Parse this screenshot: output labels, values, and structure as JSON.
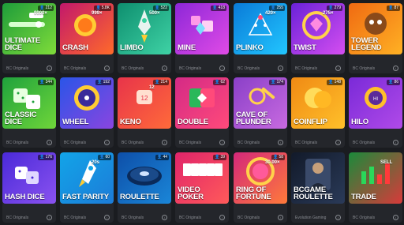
{
  "games": [
    {
      "title": "ULTIMATE DICE",
      "players": "212",
      "provider": "BC Originals",
      "badge": "9900×",
      "bg": [
        "#1e9c3a",
        "#7fdc3a"
      ]
    },
    {
      "title": "CRASH",
      "players": "5.8K",
      "provider": "BC Originals",
      "badge": "999×",
      "bg": [
        "#c2186b",
        "#ff6a2a"
      ]
    },
    {
      "title": "LIMBO",
      "players": "522",
      "provider": "BC Originals",
      "badge": "500×",
      "bg": [
        "#0e8f6f",
        "#3fd2a5"
      ]
    },
    {
      "title": "MINE",
      "players": "418",
      "provider": "BC Originals",
      "badge": "",
      "bg": [
        "#8d27d8",
        "#e04be6"
      ]
    },
    {
      "title": "PLINKO",
      "players": "255",
      "provider": "BC Originals",
      "badge": "420×",
      "bg": [
        "#0a7bd8",
        "#22c6ff"
      ]
    },
    {
      "title": "TWIST",
      "players": "279",
      "provider": "BC Originals",
      "badge": "275×",
      "bg": [
        "#6a22d8",
        "#d54ef0"
      ]
    },
    {
      "title": "TOWER LEGEND",
      "players": "87",
      "provider": "BC Originals",
      "badge": "",
      "bg": [
        "#f06a12",
        "#ffb124"
      ]
    },
    {
      "title": "CLASSIC DICE",
      "players": "344",
      "provider": "BC Originals",
      "badge": "",
      "bg": [
        "#1fa23c",
        "#6fd63a"
      ]
    },
    {
      "title": "WHEEL",
      "players": "192",
      "provider": "BC Originals",
      "badge": "",
      "bg": [
        "#2a55e8",
        "#8a45e0"
      ]
    },
    {
      "title": "KENO",
      "players": "214",
      "provider": "BC Originals",
      "badge": "12",
      "bg": [
        "#e8344a",
        "#ff6a3a"
      ]
    },
    {
      "title": "DOUBLE",
      "players": "62",
      "provider": "BC Originals",
      "badge": "",
      "bg": [
        "#d42a86",
        "#ff4a7a"
      ]
    },
    {
      "title": "CAVE OF PLUNDER",
      "players": "174",
      "provider": "BC Originals",
      "badge": "",
      "bg": [
        "#8a40c8",
        "#c86ae0"
      ]
    },
    {
      "title": "COINFLIP",
      "players": "148",
      "provider": "BC Originals",
      "badge": "",
      "bg": [
        "#f08a14",
        "#ffc02a"
      ]
    },
    {
      "title": "HILO",
      "players": "86",
      "provider": "BC Originals",
      "badge": "",
      "bg": [
        "#7a2ad8",
        "#b04ae8"
      ]
    },
    {
      "title": "HASH DICE",
      "players": "176",
      "provider": "BC Originals",
      "badge": "",
      "bg": [
        "#4a2ad8",
        "#8a52f0"
      ]
    },
    {
      "title": "FAST PARITY",
      "players": "60",
      "provider": "BC Originals",
      "badge": "20s",
      "bg": [
        "#12a4e8",
        "#1c7cd8"
      ]
    },
    {
      "title": "ROULETTE",
      "players": "44",
      "provider": "BC Originals",
      "badge": "",
      "bg": [
        "#0e4fa8",
        "#1a86d8"
      ]
    },
    {
      "title": "VIDEO POKER",
      "players": "39",
      "provider": "BC Originals",
      "badge": "",
      "bg": [
        "#e0246a",
        "#ff5a5a"
      ]
    },
    {
      "title": "RING OF FORTUNE",
      "players": "58",
      "provider": "BC Originals",
      "badge": "30.00×",
      "bg": [
        "#d4287a",
        "#ff7a3a"
      ]
    },
    {
      "title": "BCGAME ROULETTE",
      "players": "",
      "provider": "Evolution Gaming",
      "badge": "",
      "bg": [
        "#121a2a",
        "#2a3a58"
      ]
    },
    {
      "title": "TRADE",
      "players": "",
      "provider": "BC Originals",
      "badge": "SELL",
      "bg": [
        "#1a8a3a",
        "#d83a3a"
      ]
    }
  ]
}
